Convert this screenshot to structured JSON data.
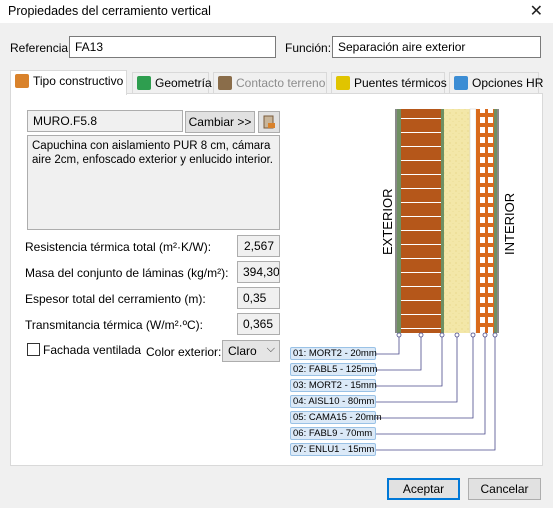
{
  "window": {
    "title": "Propiedades del cerramiento vertical",
    "close_glyph": "✕"
  },
  "header": {
    "referencia_label": "Referencia:",
    "referencia_value": "FA13",
    "funcion_label": "Función:",
    "funcion_value": "Separación aire exterior"
  },
  "tabs": [
    {
      "label": "Tipo constructivo",
      "icon": "layers-icon",
      "color": "#d9822b",
      "active": true,
      "enabled": true
    },
    {
      "label": "Geometría",
      "icon": "geometry-icon",
      "color": "#2e9e4f",
      "active": false,
      "enabled": true
    },
    {
      "label": "Contacto terreno",
      "icon": "ground-icon",
      "color": "#8a6d4a",
      "active": false,
      "enabled": false
    },
    {
      "label": "Puentes térmicos",
      "icon": "thermal-bridge-icon",
      "color": "#e0c400",
      "active": false,
      "enabled": true
    },
    {
      "label": "Opciones HR",
      "icon": "humidity-icon",
      "color": "#3c8dd4",
      "active": false,
      "enabled": true
    }
  ],
  "construction": {
    "code": "MURO.F5.8",
    "change_button": "Cambiar >>",
    "edit_icon": "edit-icon",
    "description": "Capuchina con aislamiento PUR 8 cm, cámara aire 2cm, enfoscado exterior y enlucido interior."
  },
  "properties": [
    {
      "label": "Resistencia térmica total (m²·K/W):",
      "value": "2,567"
    },
    {
      "label": "Masa del conjunto de láminas (kg/m²):",
      "value": "394,30"
    },
    {
      "label": "Espesor total del cerramiento (m):",
      "value": "0,35"
    },
    {
      "label": "Transmitancia térmica (W/m²·ºC):",
      "value": "0,365"
    }
  ],
  "options": {
    "fachada_label": "Fachada ventilada",
    "fachada_checked": false,
    "color_label": "Color exterior:",
    "color_value": "Claro"
  },
  "diagram": {
    "exterior_label": "EXTERIOR",
    "interior_label": "INTERIOR",
    "layers": [
      "01: MORT2 - 20mm",
      "02: FABL5 - 125mm",
      "03: MORT2 - 15mm",
      "04: AISL10 - 80mm",
      "05: CAMA15 - 20mm",
      "06: FABL9 - 70mm",
      "07: ENLU1 - 15mm"
    ],
    "colors": {
      "brick": "#b5571a",
      "insulation": "#f3e7a8",
      "mortar": "#6f8f62",
      "hollow_brick": "#d96a1c"
    }
  },
  "footer": {
    "accept": "Aceptar",
    "cancel": "Cancelar"
  }
}
